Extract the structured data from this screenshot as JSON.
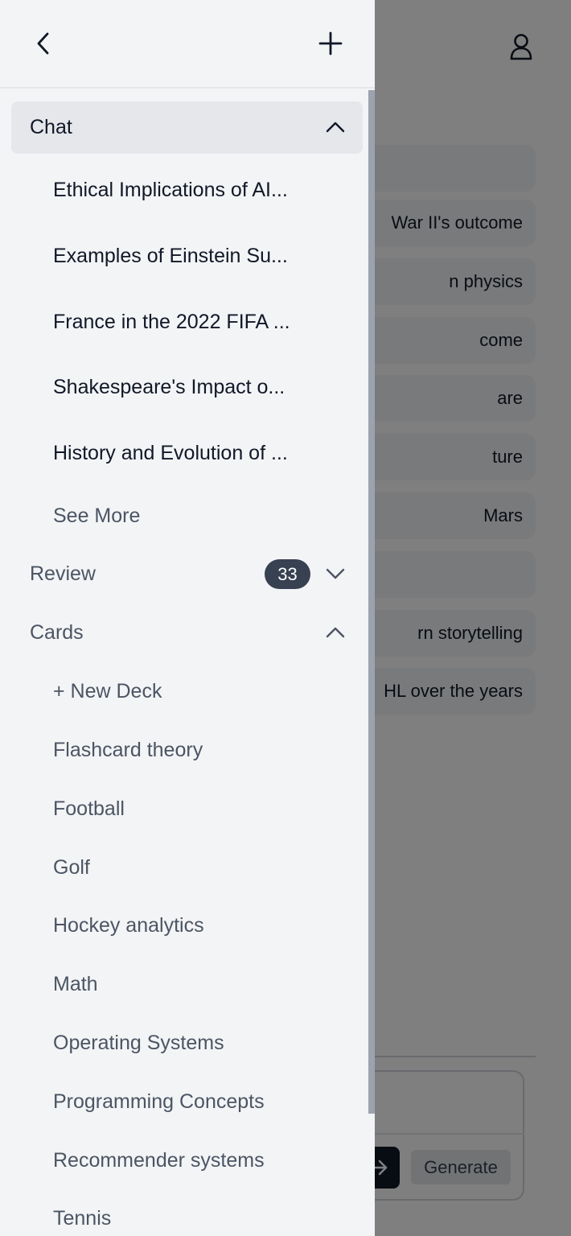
{
  "background": {
    "suggestions": [
      {
        "text": "Key factors in World War II's outcome",
        "visible": "War II's outcome"
      },
      {
        "text": "Einstein's impact on modern physics",
        "visible": "n physics"
      },
      {
        "text": "France's World Cup outcome",
        "visible": "come"
      },
      {
        "text": "Shakespeare",
        "visible": "are"
      },
      {
        "text": "Future",
        "visible": "ture"
      },
      {
        "text": "Life on Mars",
        "visible": "Mars"
      },
      {
        "text": "",
        "visible": ""
      },
      {
        "text": "Modern storytelling",
        "visible": "rn storytelling"
      },
      {
        "text": "The NHL over the years",
        "visible": "HL over the years"
      }
    ],
    "generate_label": "Generate"
  },
  "sidebar": {
    "chat": {
      "label": "Chat",
      "items": [
        "Ethical Implications of AI...",
        "Examples of Einstein Su...",
        "France in the 2022 FIFA ...",
        "Shakespeare's Impact o...",
        "History and Evolution of ..."
      ],
      "see_more": "See More"
    },
    "review": {
      "label": "Review",
      "count": "33"
    },
    "cards": {
      "label": "Cards",
      "new_deck": "+ New Deck",
      "decks": [
        "Flashcard theory",
        "Football",
        "Golf",
        "Hockey analytics",
        "Math",
        "Operating Systems",
        "Programming Concepts",
        "Recommender systems",
        "Tennis"
      ]
    }
  },
  "icons": {
    "back": "chevron-left-icon",
    "new": "plus-icon",
    "profile": "user-icon",
    "expand_open": "chevron-up-icon",
    "expand_closed": "chevron-down-icon",
    "send": "arrow-right-icon"
  },
  "colors": {
    "drawer_bg": "#f3f4f6",
    "active_section_bg": "#e5e7eb",
    "badge_bg": "#374151",
    "overlay": "rgba(0,0,0,0.5)"
  }
}
